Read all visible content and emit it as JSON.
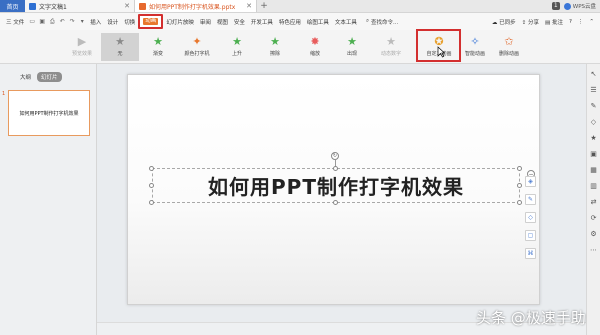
{
  "titlebar": {
    "home_tab": "首页",
    "tabs": [
      {
        "label": "文字文稿1"
      },
      {
        "label": "如何用PPT制作打字机效果.pptx"
      }
    ],
    "new_tab": "+",
    "badge": "1",
    "cloud_label": "WPS云盘"
  },
  "menubar": {
    "file": "三 文件",
    "items_left": [
      "插入",
      "设计",
      "切换"
    ],
    "active_tab": "动画",
    "items_right": [
      "幻灯片放映",
      "审阅",
      "视图",
      "安全",
      "开发工具",
      "特色应用",
      "绘图工具",
      "文本工具"
    ],
    "search": "查找命令...",
    "sync": "已同步",
    "share": "分享",
    "comment": "批注",
    "help": "?"
  },
  "ribbon": {
    "buttons": [
      {
        "label": "预览效果",
        "icon": "preview-icon",
        "state": "disabled"
      },
      {
        "label": "无",
        "icon": "star-icon",
        "state": "selected"
      },
      {
        "label": "渐变",
        "icon": "star-icon",
        "state": "normal"
      },
      {
        "label": "颜色打字机",
        "icon": "star-icon",
        "state": "normal"
      },
      {
        "label": "上升",
        "icon": "star-icon",
        "state": "normal"
      },
      {
        "label": "擦除",
        "icon": "star-icon",
        "state": "normal"
      },
      {
        "label": "缩放",
        "icon": "star-icon",
        "state": "normal"
      },
      {
        "label": "出现",
        "icon": "star-icon",
        "state": "normal"
      },
      {
        "label": "动态数字",
        "icon": "star-icon",
        "state": "disabled"
      },
      {
        "label": "自定义动画",
        "icon": "star-icon",
        "state": "highlighted"
      },
      {
        "label": "智能动画",
        "icon": "star-icon",
        "state": "normal"
      },
      {
        "label": "删除动画",
        "icon": "star-icon",
        "state": "normal"
      }
    ]
  },
  "leftpane": {
    "tabs": [
      "大纲",
      "幻灯片"
    ],
    "slide_number": "1",
    "thumb_text": "如何用PPT制作打字机效果"
  },
  "slide": {
    "title": "如何用PPT制作打字机效果"
  },
  "watermark": "头条 @极速手助",
  "colors": {
    "accent_orange": "#e8772d",
    "highlight_red": "#d32f2f",
    "home_blue": "#3a6fc4"
  }
}
